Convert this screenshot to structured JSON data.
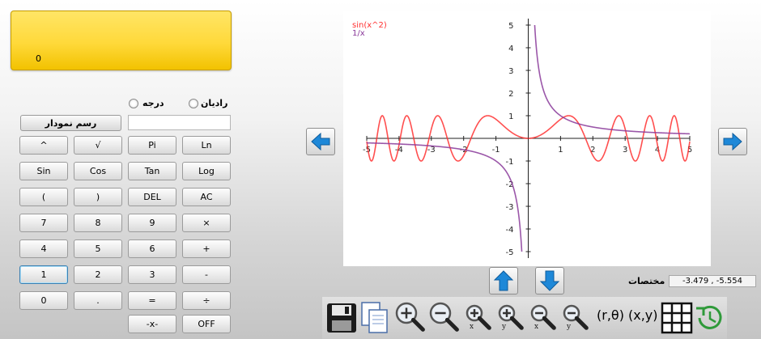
{
  "display": {
    "value": "0"
  },
  "angle_mode": {
    "degree_label": "درجه",
    "radian_label": "رادیان"
  },
  "graph_button": {
    "label": "رسم نمودار"
  },
  "function_input": {
    "value": ""
  },
  "keypad": [
    [
      "^",
      "√",
      "Pi",
      "Ln"
    ],
    [
      "Sin",
      "Cos",
      "Tan",
      "Log"
    ],
    [
      "(",
      ")",
      "DEL",
      "AC"
    ],
    [
      "7",
      "8",
      "9",
      "×"
    ],
    [
      "4",
      "5",
      "6",
      "+"
    ],
    [
      "1",
      "2",
      "3",
      "-"
    ],
    [
      "0",
      ".",
      "=",
      "÷"
    ],
    [
      "",
      "",
      "-x-",
      "OFF"
    ]
  ],
  "coordinates": {
    "label": "مختصات :",
    "value": "-3.479 , -5.554"
  },
  "toolbar": {
    "polar_label": "(r,θ)",
    "cartesian_label": "(x,y)"
  },
  "colors": {
    "display": "#ffd93a",
    "accent_blue": "#1e88d8",
    "series_sin": "#ff3030",
    "series_inv": "#8a3a9a"
  },
  "icons": {
    "left": "arrow-left-icon",
    "right": "arrow-right-icon",
    "up": "arrow-up-icon",
    "down": "arrow-down-icon",
    "save": "save-icon",
    "copy": "copy-icon",
    "zoom_in": "zoom-in-icon",
    "zoom_out": "zoom-out-icon",
    "grid": "grid-icon",
    "history": "history-icon"
  },
  "chart_data": {
    "type": "line",
    "title": "",
    "xlim": [
      -5,
      5
    ],
    "ylim": [
      -5,
      5
    ],
    "x_ticks": [
      -5,
      -4,
      -3,
      -2,
      -1,
      1,
      2,
      3,
      4,
      5
    ],
    "y_ticks": [
      -5,
      -4,
      -3,
      -2,
      -1,
      1,
      2,
      3,
      4,
      5
    ],
    "grid": false,
    "legend_position": "top-left",
    "series": [
      {
        "name": "sin(x^2)",
        "function": "sin(x^2)",
        "color": "#ff3030"
      },
      {
        "name": "1/x",
        "function": "1/x",
        "color": "#8a3a9a"
      }
    ]
  }
}
